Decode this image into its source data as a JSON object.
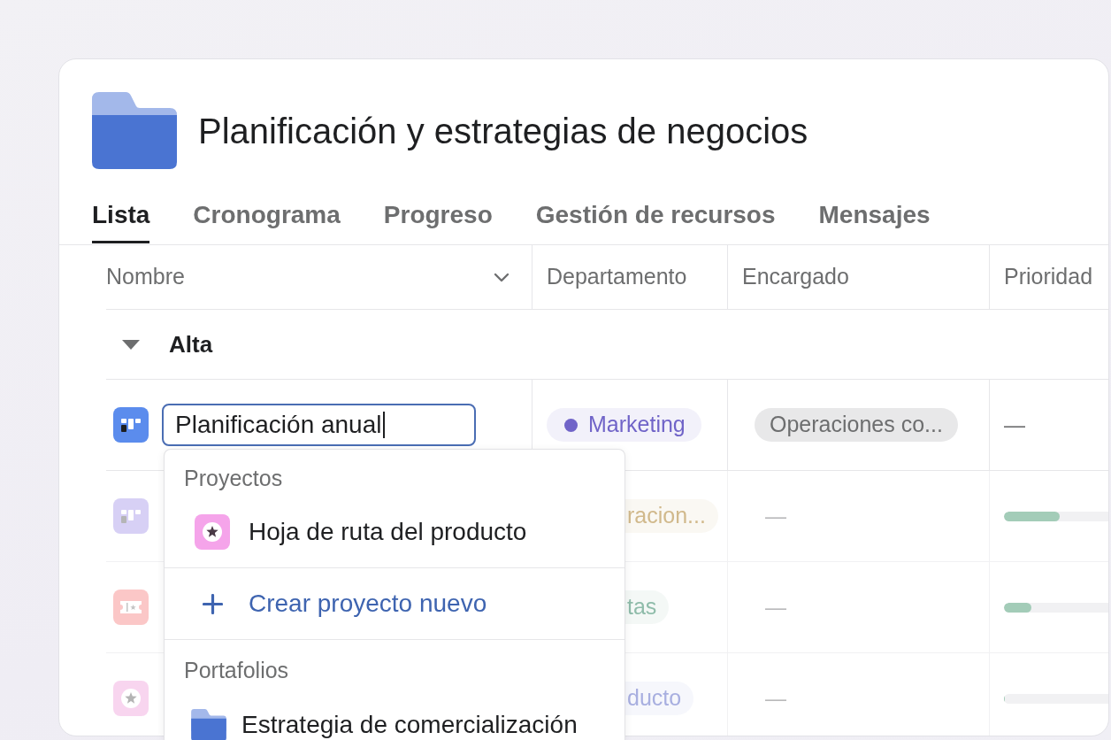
{
  "header": {
    "title": "Planificación y estrategias de negocios"
  },
  "tabs": [
    {
      "label": "Lista",
      "selected": true
    },
    {
      "label": "Cronograma",
      "selected": false
    },
    {
      "label": "Progreso",
      "selected": false
    },
    {
      "label": "Gestión de recursos",
      "selected": false
    },
    {
      "label": "Mensajes",
      "selected": false
    }
  ],
  "table": {
    "columns": [
      {
        "label": "Nombre"
      },
      {
        "label": "Departamento"
      },
      {
        "label": "Encargado"
      },
      {
        "label": "Prioridad"
      }
    ],
    "groups": [
      {
        "label": "Alta",
        "expanded": true,
        "rows": [
          {
            "dimmed": false,
            "name": "Planificación anual",
            "department": {
              "label": "Marketing",
              "color": "#7064c8"
            },
            "assignee": {
              "kind": "tag",
              "label": "Operaciones co..."
            },
            "priority": {
              "kind": "text",
              "label": "—"
            }
          },
          {
            "dimmed": true,
            "department": {
              "label": "racion...",
              "color": "#d1b98c"
            },
            "assignee": {
              "kind": "text",
              "label": "—"
            },
            "priority": {
              "kind": "bar",
              "level": 0.53
            }
          },
          {
            "dimmed": true,
            "department": {
              "label": "tas",
              "color": "#8fbcaa"
            },
            "assignee": {
              "kind": "text",
              "label": "—"
            },
            "priority": {
              "kind": "bar",
              "level": 0.26
            }
          },
          {
            "dimmed": true,
            "department": {
              "label": "ducto",
              "color": "#a8afe0"
            },
            "assignee": {
              "kind": "text",
              "label": "—"
            },
            "priority": {
              "kind": "bar",
              "level": 0
            }
          }
        ]
      }
    ]
  },
  "dropdown": {
    "entries": [
      {
        "kind": "header",
        "label": "Proyectos"
      },
      {
        "kind": "project",
        "label": "Hoja de ruta del producto"
      },
      {
        "kind": "action",
        "label": "Crear proyecto nuevo"
      },
      {
        "kind": "header",
        "label": "Portafolios"
      },
      {
        "kind": "portfolio",
        "label": "Estrategia de comercialización"
      }
    ]
  }
}
